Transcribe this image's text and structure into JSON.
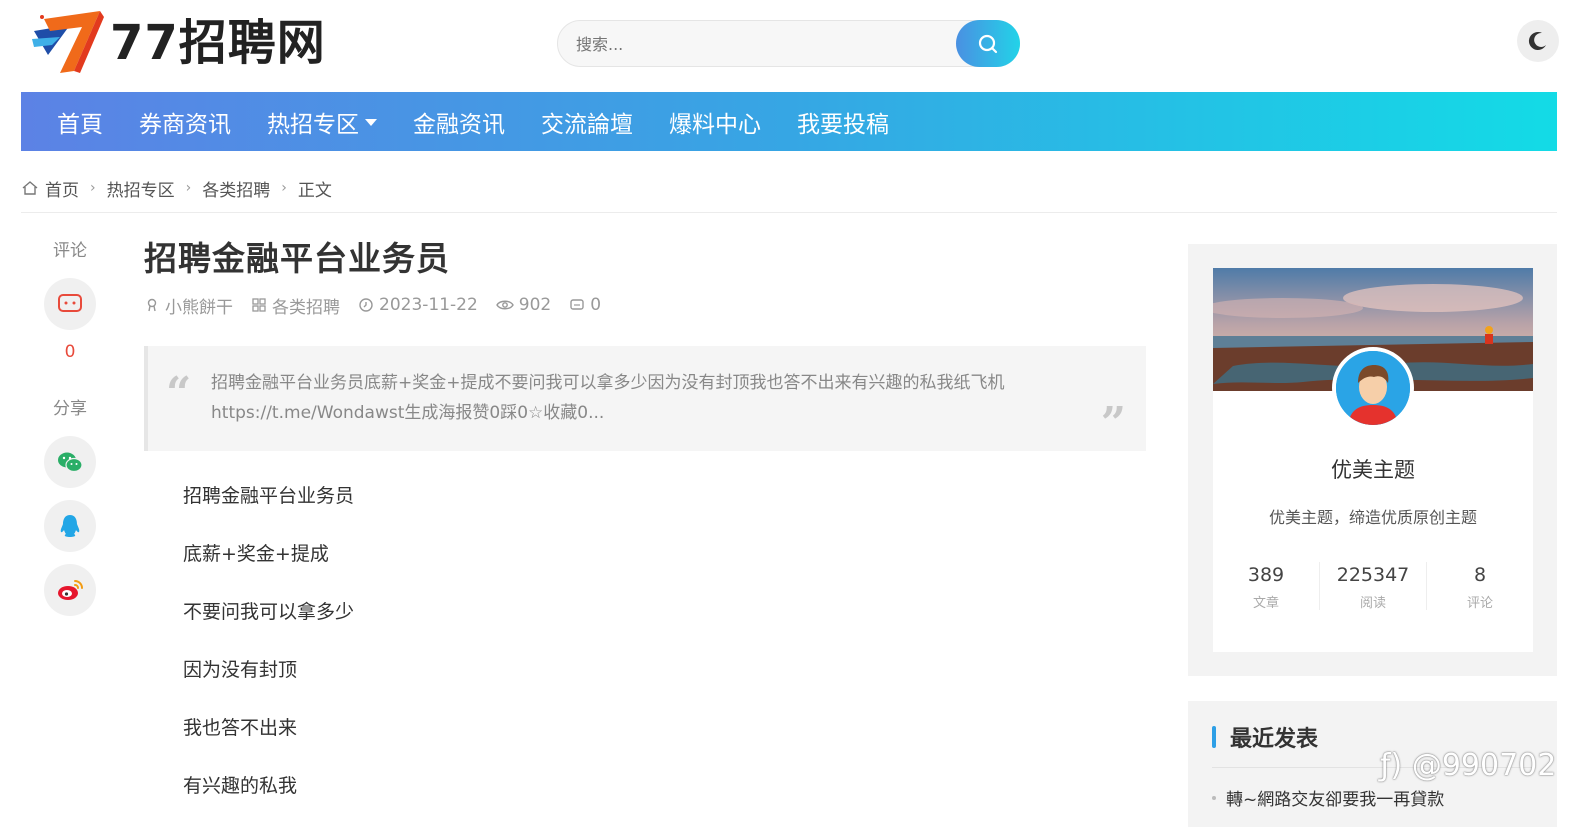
{
  "site": {
    "logo_text": "77招聘网"
  },
  "search": {
    "placeholder": "搜索..."
  },
  "nav": {
    "items": [
      "首頁",
      "券商资讯",
      "热招专区",
      "金融资讯",
      "交流論壇",
      "爆料中心",
      "我要投稿"
    ]
  },
  "breadcrumb": {
    "items": [
      "首页",
      "热招专区",
      "各类招聘",
      "正文"
    ]
  },
  "side": {
    "comment_label": "评论",
    "comment_count": "0",
    "share_label": "分享",
    "icons": [
      "wechat-icon",
      "qq-icon",
      "weibo-icon"
    ]
  },
  "article": {
    "title": "招聘金融平台业务员",
    "meta": {
      "author": "小熊餅干",
      "category": "各类招聘",
      "date": "2023-11-22",
      "views": "902",
      "comments": "0"
    },
    "excerpt_line1": "招聘金融平台业务员底薪+奖金+提成不要问我可以拿多少因为没有封顶我也答不出来有兴趣的私我纸飞机",
    "excerpt_line2": "https://t.me/Wondawst生成海报赞0踩0☆收藏0...",
    "paragraphs": [
      "招聘金融平台业务员",
      "底薪+奖金+提成",
      "不要问我可以拿多少",
      "因为没有封顶",
      "我也答不出来",
      "有兴趣的私我"
    ]
  },
  "profile": {
    "name": "优美主题",
    "description": "优美主题，缔造优质原创主题",
    "stats": [
      {
        "value": "389",
        "label": "文章"
      },
      {
        "value": "225347",
        "label": "阅读"
      },
      {
        "value": "8",
        "label": "评论"
      }
    ]
  },
  "recent": {
    "title": "最近发表",
    "items": [
      "轉~網路交友卻要我一再貸款"
    ]
  },
  "watermark": "@990702",
  "colors": {
    "nav_start": "#5c82e5",
    "nav_end": "#13dbe6",
    "accent": "#2d9fe6",
    "comment_count": "#e84a3b"
  }
}
